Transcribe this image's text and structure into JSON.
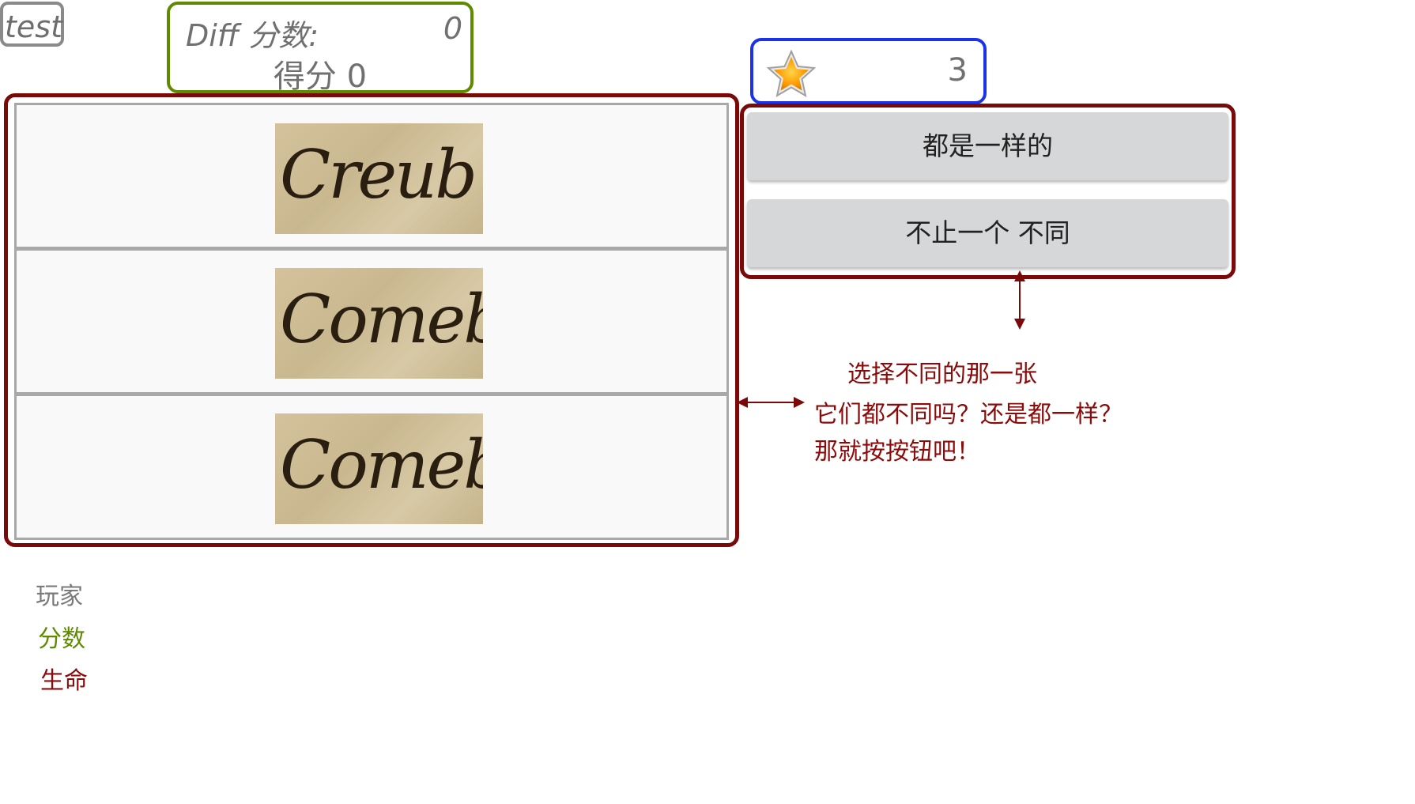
{
  "player": {
    "name": "test"
  },
  "score_box": {
    "diff_label": "Diff 分数:",
    "diff_value": "0",
    "score_text": "得分 0"
  },
  "lives": {
    "icon": "star-icon",
    "value": "3"
  },
  "images": [
    {
      "word": "Creub"
    },
    {
      "word": "Comeb"
    },
    {
      "word": "Comeb"
    }
  ],
  "buttons": {
    "all_same": "都是一样的",
    "more_than_one": "不止一个 不同"
  },
  "hint": {
    "line1": "选择不同的那一张",
    "line2": "它们都不同吗？还是都一样？",
    "line3": "那就按按钮吧！"
  },
  "legend": {
    "player": "玩家",
    "score": "分数",
    "lives": "生命"
  },
  "colors": {
    "player": "#8a8a8a",
    "score": "#5f8a00",
    "lives": "#1a33e6",
    "panel": "#7a0a0a",
    "hint": "#8b0a0a"
  }
}
